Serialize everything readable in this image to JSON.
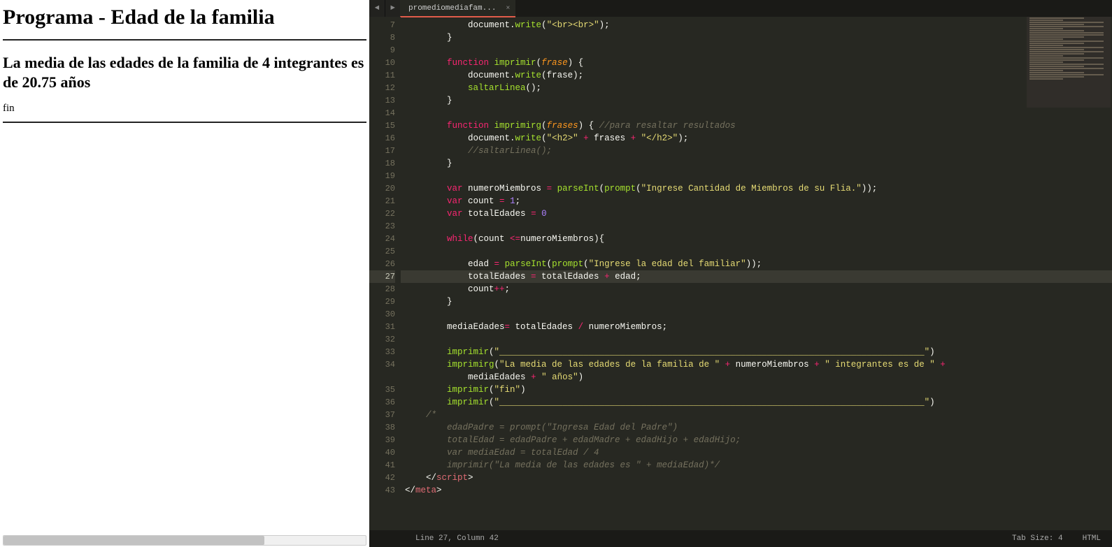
{
  "browser": {
    "title": "Programa - Edad de la familia",
    "result_heading": "La media de las edades de la familia de 4 integrantes es de 20.75 años",
    "fin_text": "fin"
  },
  "editor": {
    "tab_name": "promediomediafam...",
    "tab_close": "×",
    "nav_back": "◄",
    "nav_fwd": "►",
    "line_start": 7,
    "line_end": 43,
    "highlighted_line": 27,
    "status": {
      "cursor": "Line 27, Column 42",
      "tab_size": "Tab Size: 4",
      "lang": "HTML"
    },
    "code": [
      {
        "n": 7,
        "h": "            <span class='id'>document</span>.<span class='fn'>write</span>(<span class='str'>\"&lt;br&gt;&lt;br&gt;\"</span>);"
      },
      {
        "n": 8,
        "h": "        }"
      },
      {
        "n": 9,
        "h": ""
      },
      {
        "n": 10,
        "h": "        <span class='kw'>function</span> <span class='fn'>imprimir</span>(<span class='pr'>frase</span>) {"
      },
      {
        "n": 11,
        "h": "            <span class='id'>document</span>.<span class='fn'>write</span>(frase);"
      },
      {
        "n": 12,
        "h": "            <span class='fn'>saltarLinea</span>();"
      },
      {
        "n": 13,
        "h": "        }"
      },
      {
        "n": 14,
        "h": ""
      },
      {
        "n": 15,
        "h": "        <span class='kw'>function</span> <span class='fn'>imprimirg</span>(<span class='pr'>frases</span>) { <span class='cm'>//para resaltar resultados</span>"
      },
      {
        "n": 16,
        "h": "            <span class='id'>document</span>.<span class='fn'>write</span>(<span class='str'>\"&lt;h2&gt;\"</span> <span class='op'>+</span> frases <span class='op'>+</span> <span class='str'>\"&lt;/h2&gt;\"</span>);"
      },
      {
        "n": 17,
        "h": "            <span class='cm'>//saltarLinea();</span>"
      },
      {
        "n": 18,
        "h": "        }"
      },
      {
        "n": 19,
        "h": ""
      },
      {
        "n": 20,
        "h": "        <span class='kw'>var</span> numeroMiembros <span class='op'>=</span> <span class='fn'>parseInt</span>(<span class='fn'>prompt</span>(<span class='str'>\"Ingrese Cantidad de Miembros de su Flia.\"</span>));"
      },
      {
        "n": 21,
        "h": "        <span class='kw'>var</span> count <span class='op'>=</span> <span class='num'>1</span>;"
      },
      {
        "n": 22,
        "h": "        <span class='kw'>var</span> totalEdades <span class='op'>=</span> <span class='num'>0</span>"
      },
      {
        "n": 23,
        "h": ""
      },
      {
        "n": 24,
        "h": "        <span class='kw'>while</span>(count <span class='op'>&lt;=</span>numeroMiembros){"
      },
      {
        "n": 25,
        "h": ""
      },
      {
        "n": 26,
        "h": "            edad <span class='op'>=</span> <span class='fn'>parseInt</span>(<span class='fn'>prompt</span>(<span class='str'>\"Ingrese la edad del familiar\"</span>));"
      },
      {
        "n": 27,
        "h": "            totalEdades <span class='op'>=</span> totalEdades <span class='op'>+</span> edad;"
      },
      {
        "n": 28,
        "h": "            count<span class='op'>++</span>;"
      },
      {
        "n": 29,
        "h": "        }"
      },
      {
        "n": 30,
        "h": ""
      },
      {
        "n": 31,
        "h": "        mediaEdades<span class='op'>=</span> totalEdades <span class='op'>/</span> numeroMiembros;"
      },
      {
        "n": 32,
        "h": ""
      },
      {
        "n": 33,
        "h": "        <span class='fn'>imprimir</span>(<span class='str'>\"_________________________________________________________________________________\"</span>)"
      },
      {
        "n": 34,
        "h": "        <span class='fn'>imprimirg</span>(<span class='str'>\"La media de las edades de la familia de \"</span> <span class='op'>+</span> numeroMiembros <span class='op'>+</span> <span class='str'>\" integrantes es de \"</span> <span class='op'>+</span>"
      },
      {
        "n": "",
        "h": "            mediaEdades <span class='op'>+</span> <span class='str'>\" años\"</span>)"
      },
      {
        "n": 35,
        "h": "        <span class='fn'>imprimir</span>(<span class='str'>\"fin\"</span>)"
      },
      {
        "n": 36,
        "h": "        <span class='fn'>imprimir</span>(<span class='str'>\"_________________________________________________________________________________\"</span>)"
      },
      {
        "n": 37,
        "h": "    <span class='cm'>/*</span>"
      },
      {
        "n": 38,
        "h": "<span class='cm'>        edadPadre = prompt(\"Ingresa Edad del Padre\")</span>"
      },
      {
        "n": 39,
        "h": "<span class='cm'>        totalEdad = edadPadre + edadMadre + edadHijo + edadHijo;</span>"
      },
      {
        "n": 40,
        "h": "<span class='cm'>        var mediaEdad = totalEdad / 4</span>"
      },
      {
        "n": 41,
        "h": "<span class='cm'>        imprimir(\"La media de las edades es \" + mediaEdad)*/</span>"
      },
      {
        "n": 42,
        "h": "    &lt;/<span class='tag2'>script</span>&gt;"
      },
      {
        "n": 43,
        "h": "&lt;/<span class='tag2'>meta</span>&gt;"
      }
    ]
  }
}
